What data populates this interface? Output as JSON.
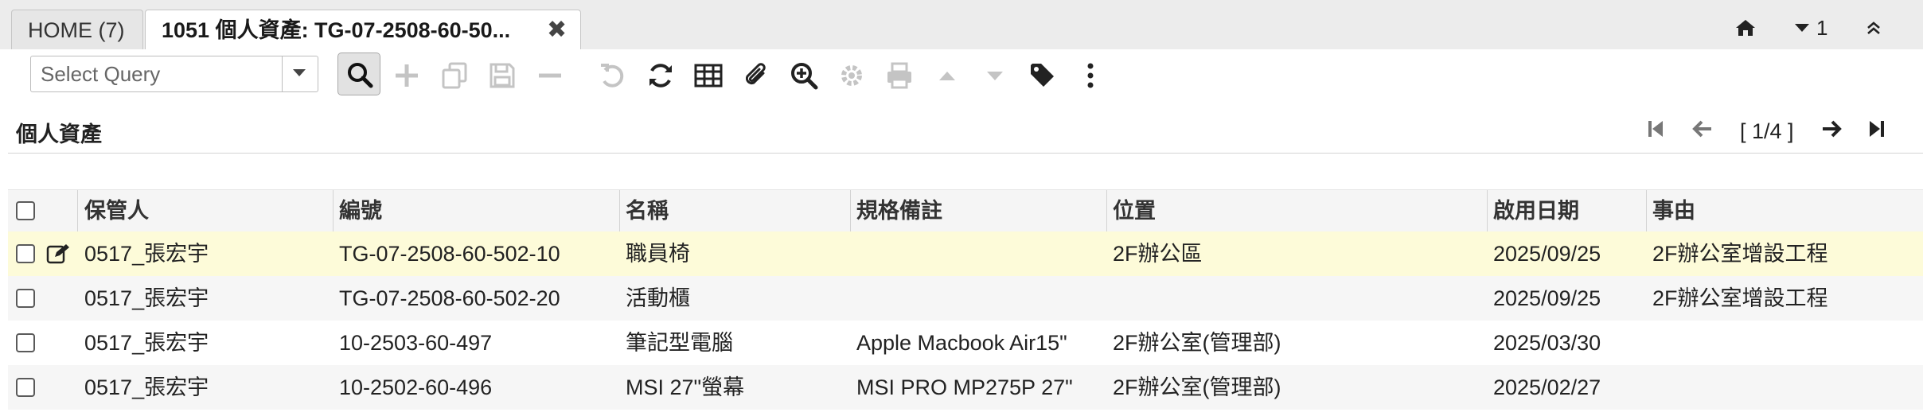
{
  "tabs": [
    {
      "label": "HOME (7)"
    },
    {
      "label": "1051 個人資產: TG-07-2508-60-50..."
    }
  ],
  "top_right": {
    "count": "1"
  },
  "toolbar": {
    "query_placeholder": "Select Query",
    "icons": [
      "search-icon",
      "new-icon",
      "copy-icon",
      "save-icon",
      "delete-icon",
      "undo-icon",
      "refresh-icon",
      "grid-toggle-icon",
      "attachment-icon",
      "zoom-icon",
      "process-icon",
      "print-icon",
      "previous-record-icon",
      "next-record-icon",
      "tag-icon",
      "more-icon"
    ]
  },
  "panel": {
    "title": "個人資產",
    "page_status": "[ 1/4 ]"
  },
  "grid": {
    "columns": [
      "保管人",
      "編號",
      "名稱",
      "規格備註",
      "位置",
      "啟用日期",
      "事由"
    ],
    "rows": [
      {
        "custodian": "0517_張宏宇",
        "number": "TG-07-2508-60-502-10",
        "name": "職員椅",
        "spec": "",
        "location": "2F辦公區",
        "start_date": "2025/09/25",
        "reason": "2F辦公室增設工程"
      },
      {
        "custodian": "0517_張宏宇",
        "number": "TG-07-2508-60-502-20",
        "name": "活動櫃",
        "spec": "",
        "location": "",
        "start_date": "2025/09/25",
        "reason": "2F辦公室增設工程"
      },
      {
        "custodian": "0517_張宏宇",
        "number": "10-2503-60-497",
        "name": "筆記型電腦",
        "spec": "Apple Macbook Air15\"",
        "location": "2F辦公室(管理部)",
        "start_date": "2025/03/30",
        "reason": ""
      },
      {
        "custodian": "0517_張宏宇",
        "number": "10-2502-60-496",
        "name": "MSI 27\"螢幕",
        "spec": "MSI PRO MP275P 27\"",
        "location": "2F辦公室(管理部)",
        "start_date": "2025/02/27",
        "reason": ""
      }
    ]
  },
  "colors": {
    "selected_row": "#fdfbd9",
    "alt_row": "#f6f6f6",
    "header_bg": "#f5f5f5",
    "icon_dark": "#222222",
    "icon_disabled": "#c4c4c4"
  }
}
